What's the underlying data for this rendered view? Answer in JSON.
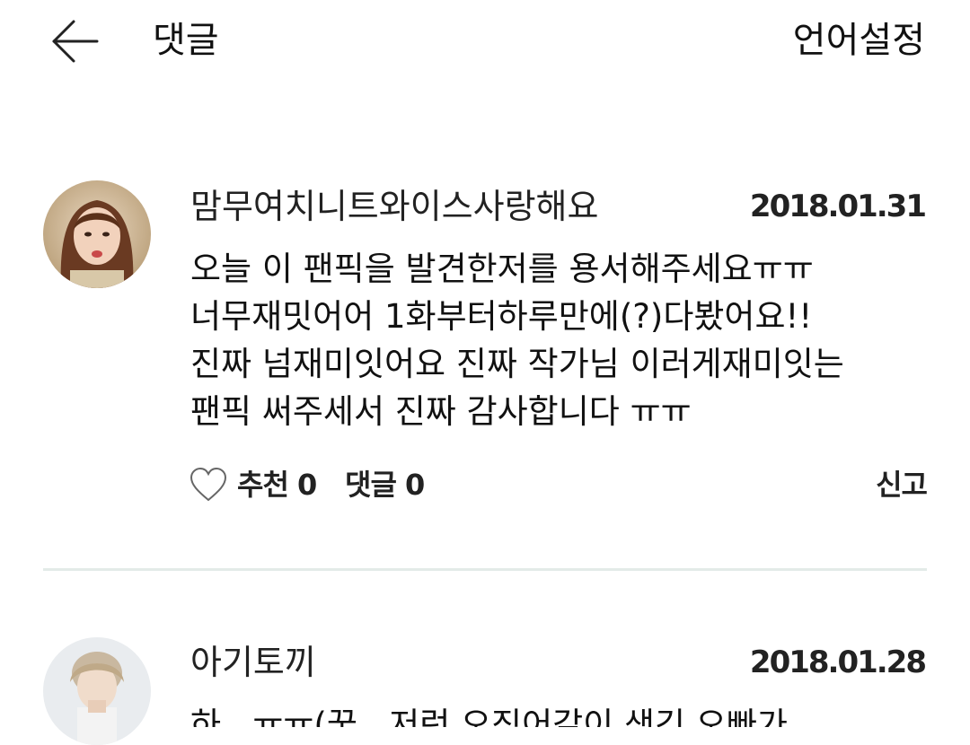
{
  "header": {
    "title": "댓글",
    "language_label": "언어설정"
  },
  "comments": [
    {
      "author": "맘무여치니트와이스사랑해요",
      "date": "2018.01.31",
      "lines": [
        "오늘 이 팬픽을 발견한저를 용서해주세요ㅠㅠ",
        "너무재밋어어 1화부터하루만에(?)다봤어요!!",
        "진짜 넘재미잇어요 진짜 작가님 이러게재미잇는",
        "팬픽 써주세서 진짜 감사합니다 ㅠㅠ"
      ],
      "likes_label": "추천 0",
      "replies_label": "댓글 0",
      "report_label": "신고"
    },
    {
      "author": "아기토끼",
      "date": "2018.01.28",
      "lines": [
        "하...ㅠㅠ(꾹.. 저런 오징어같이 생긴 오빠가"
      ]
    }
  ]
}
